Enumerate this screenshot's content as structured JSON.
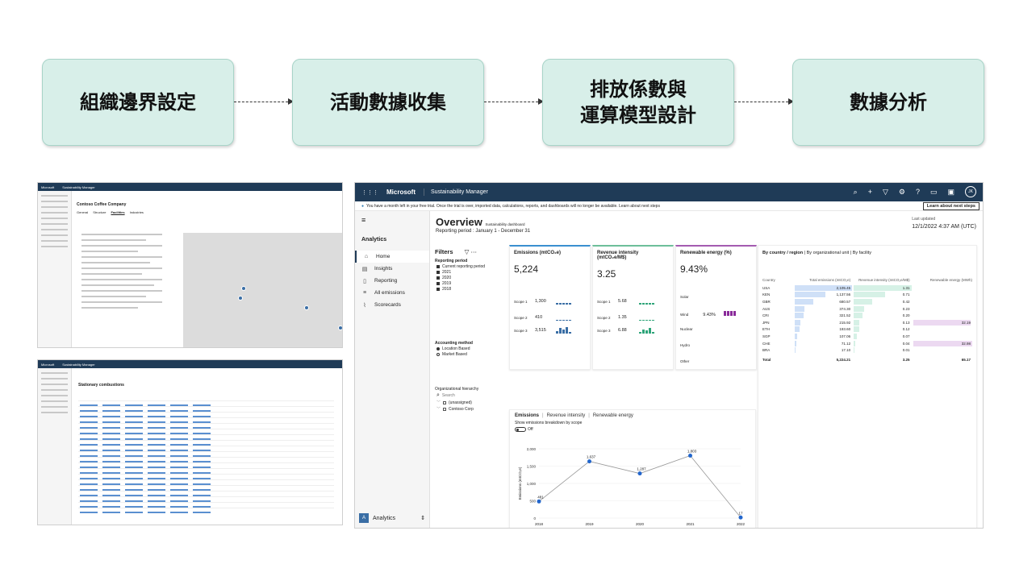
{
  "flow": {
    "steps": [
      "組織邊界設定",
      "活動數據收集",
      "排放係數與\n運算模型設計",
      "數據分析"
    ]
  },
  "app": {
    "brand": "Microsoft",
    "name": "Sustainability Manager",
    "avatar": "JK",
    "banner_text": "You have a month left in your free trial. Once the trial is over, imported data, calculations, reports, and dashboards will no longer be available. Learn about next steps",
    "banner_button": "Learn about next steps"
  },
  "sidebar": {
    "header": "Analytics",
    "items": [
      {
        "label": "Home",
        "icon": "home-icon",
        "glyph": "⌂"
      },
      {
        "label": "Insights",
        "icon": "insights-icon",
        "glyph": "▤"
      },
      {
        "label": "Reporting",
        "icon": "reporting-icon",
        "glyph": "▯"
      },
      {
        "label": "All emissions",
        "icon": "emissions-icon",
        "glyph": "≡"
      },
      {
        "label": "Scorecards",
        "icon": "scorecards-icon",
        "glyph": "⌇"
      }
    ],
    "footer_badge": "A",
    "footer_label": "Analytics"
  },
  "overview": {
    "title": "Overview",
    "subtitle": "Sustainability dashboard",
    "period": "Reporting period : January 1 - December 31",
    "updated_label": "Last updated",
    "updated_value": "12/1/2022 4:37 AM (UTC)"
  },
  "filters": {
    "title": "Filters",
    "reporting_label": "Reporting period",
    "reporting_options": [
      "Current reporting period",
      "2021",
      "2020",
      "2019",
      "2018"
    ],
    "accounting_label": "Accounting method",
    "accounting_options": [
      "Location Based",
      "Market Based"
    ],
    "search_placeholder": "Search",
    "hierarchy_label": "Organizational hierarchy",
    "hierarchy_items": [
      "(unassigned)",
      "Contoso Corp"
    ]
  },
  "kpis": {
    "emissions": {
      "title": "Emissions (mtCO₂e)",
      "value": "5,224",
      "scopes": [
        {
          "label": "Scope 1",
          "value": "1,300"
        },
        {
          "label": "Scope 2",
          "value": "410"
        },
        {
          "label": "Scope 3",
          "value": "3,515"
        }
      ]
    },
    "intensity": {
      "title": "Revenue intensity (mtCO₂e/M$)",
      "value": "3.25",
      "scopes": [
        {
          "label": "Scope 1",
          "value": "5.68"
        },
        {
          "label": "Scope 2",
          "value": "1.35"
        },
        {
          "label": "Scope 3",
          "value": "6.88"
        }
      ]
    },
    "renewable": {
      "title": "Renewable energy (%)",
      "value": "9.43%",
      "sources": [
        "Solar",
        "Wind",
        "Nuclear",
        "Hydro",
        "Other"
      ],
      "wind_value": "9.43%"
    }
  },
  "trend": {
    "tabs": [
      "Emissions",
      "Revenue intensity",
      "Renewable energy"
    ],
    "toggle_label": "Show emissions breakdown by scope",
    "toggle_state": "Off"
  },
  "chart_data": {
    "type": "line",
    "x": [
      2018,
      2019,
      2020,
      2021,
      2022
    ],
    "values": [
      481,
      1637,
      1287,
      1803,
      17
    ],
    "point_labels": [
      "481",
      "1,637",
      "1,287",
      "1,803",
      "17"
    ],
    "xlabel": "Year",
    "ylabel": "Emissions (mtCO₂e)",
    "yticks": [
      "0",
      "500",
      "1,000",
      "1,500",
      "2,000"
    ],
    "ylim": [
      0,
      2000
    ],
    "color": "#2266cc"
  },
  "country_table": {
    "tabs": [
      "By country / region",
      "By organizational unit",
      "By facility"
    ],
    "headers": [
      "Country",
      "Total emissions (mtCO₂e)",
      "Revenue intensity (mtCO₂e/M$)",
      "Renewable energy (MWh)"
    ],
    "rows": [
      {
        "country": "USA",
        "emissions": 2105.45,
        "emissions_label": "2,105.45",
        "intensity": 1.31,
        "intensity_label": "1.31",
        "renewable": 0,
        "renewable_label": ""
      },
      {
        "country": "KEN",
        "emissions": 1137.56,
        "emissions_label": "1,137.56",
        "intensity": 0.71,
        "intensity_label": "0.71",
        "renewable": 0,
        "renewable_label": ""
      },
      {
        "country": "GBR",
        "emissions": 680.57,
        "emissions_label": "680.57",
        "intensity": 0.42,
        "intensity_label": "0.42",
        "renewable": 0,
        "renewable_label": ""
      },
      {
        "country": "AUS",
        "emissions": 374.3,
        "emissions_label": "374.30",
        "intensity": 0.23,
        "intensity_label": "0.23",
        "renewable": 0,
        "renewable_label": ""
      },
      {
        "country": "CRI",
        "emissions": 321.52,
        "emissions_label": "321.52",
        "intensity": 0.2,
        "intensity_label": "0.20",
        "renewable": 0,
        "renewable_label": ""
      },
      {
        "country": "JPN",
        "emissions": 215.92,
        "emissions_label": "215.92",
        "intensity": 0.13,
        "intensity_label": "0.13",
        "renewable": 32.19,
        "renewable_label": "32.19"
      },
      {
        "country": "ETH",
        "emissions": 193.6,
        "emissions_label": "193.60",
        "intensity": 0.12,
        "intensity_label": "0.12",
        "renewable": 0,
        "renewable_label": ""
      },
      {
        "country": "SGP",
        "emissions": 107.06,
        "emissions_label": "107.06",
        "intensity": 0.07,
        "intensity_label": "0.07",
        "renewable": 0,
        "renewable_label": ""
      },
      {
        "country": "CHE",
        "emissions": 71.12,
        "emissions_label": "71.12",
        "intensity": 0.04,
        "intensity_label": "0.04",
        "renewable": 32.98,
        "renewable_label": "32.98"
      },
      {
        "country": "BRA",
        "emissions": 17.1,
        "emissions_label": "17.10",
        "intensity": 0.01,
        "intensity_label": "0.01",
        "renewable": 0,
        "renewable_label": ""
      }
    ],
    "total": {
      "label": "Total",
      "emissions": "5,224.21",
      "intensity": "3.25",
      "renewable": "65.17"
    }
  },
  "thumb_org": {
    "brand": "Microsoft",
    "app": "Sustainability Manager",
    "title": "Contoso Coffee Company",
    "tabs": [
      "General",
      "Structure",
      "Facilities",
      "Industries"
    ]
  },
  "thumb_grid": {
    "brand": "Microsoft",
    "app": "Sustainability Manager",
    "title": "Stationary combustions"
  }
}
